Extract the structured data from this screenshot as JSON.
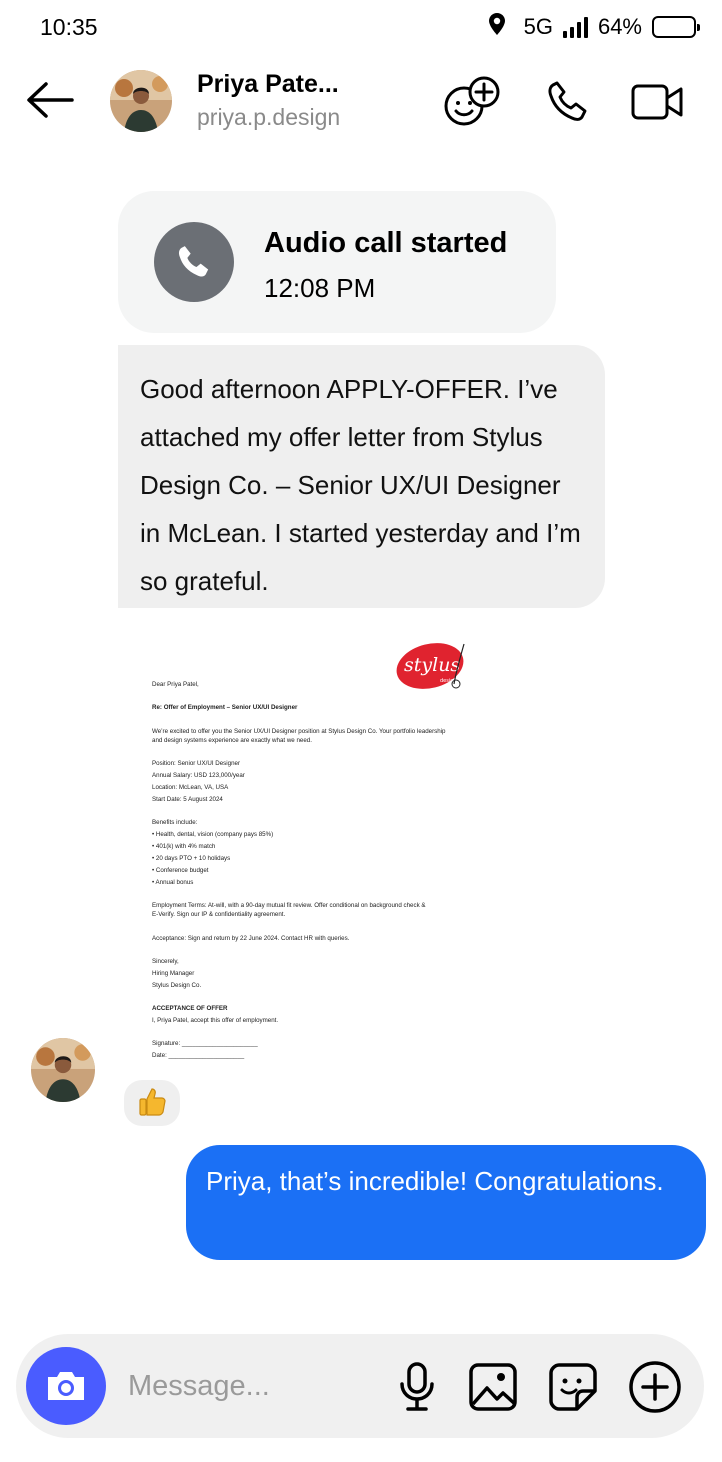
{
  "status_bar": {
    "time": "10:35",
    "network": "5G",
    "battery": "64%",
    "battery_level": 0.64
  },
  "header": {
    "contact_name": "Priya Pate...",
    "contact_handle": "priya.p.design",
    "icons": [
      "back-arrow-icon",
      "add-emoji-icon",
      "phone-icon",
      "video-camera-icon"
    ]
  },
  "call_card": {
    "title": "Audio call started",
    "time": "12:08 PM"
  },
  "incoming_message": {
    "text": "Good afternoon APPLY-OFFER. I’ve attached my offer letter from Stylus Design Co. – Senior UX/UI Designer in McLean. I started yesterday and I’m so grateful."
  },
  "offer_letter": {
    "logo_text": "stylus",
    "logo_subtext": "design",
    "lines": [
      "Dear Priya Patel,",
      "Re: Offer of Employment – Senior UX/UI Designer",
      "We’re excited to offer you the Senior UX/UI Designer position at Stylus Design Co. Your portfolio leadership",
      "and design systems experience are exactly what we need.",
      "Position: Senior UX/UI Designer",
      "Annual Salary: USD 123,000/year",
      "Location: McLean, VA, USA",
      "Start Date: 5 August 2024",
      "Benefits include:",
      "• Health, dental, vision (company pays 85%)",
      "• 401(k) with 4% match",
      "• 20 days PTO + 10 holidays",
      "• Conference budget",
      "• Annual bonus",
      "Employment Terms: At-will, with a 90-day mutual fit review. Offer conditional on background check &",
      "E-Verify. Sign our IP & confidentiality agreement.",
      "Acceptance: Sign and return by 22 June 2024. Contact HR with queries.",
      "Sincerely,",
      "Hiring Manager",
      "Stylus Design Co.",
      "ACCEPTANCE OF OFFER",
      "I, Priya Patel, accept this offer of employment.",
      "Signature: ______________________",
      "Date: ______________________"
    ]
  },
  "reaction": {
    "emoji": "👍"
  },
  "outgoing_message": {
    "text": "Priya, that’s incredible! Congratulations."
  },
  "composer": {
    "placeholder": "Message...",
    "icons": [
      "camera-icon",
      "microphone-icon",
      "gallery-icon",
      "sticker-icon",
      "plus-icon"
    ]
  },
  "colors": {
    "accent": "#1b70f5",
    "camera_button": "#4a5cff",
    "call_icon_bg": "#6b6f75",
    "incoming_bubble": "#efefef"
  }
}
